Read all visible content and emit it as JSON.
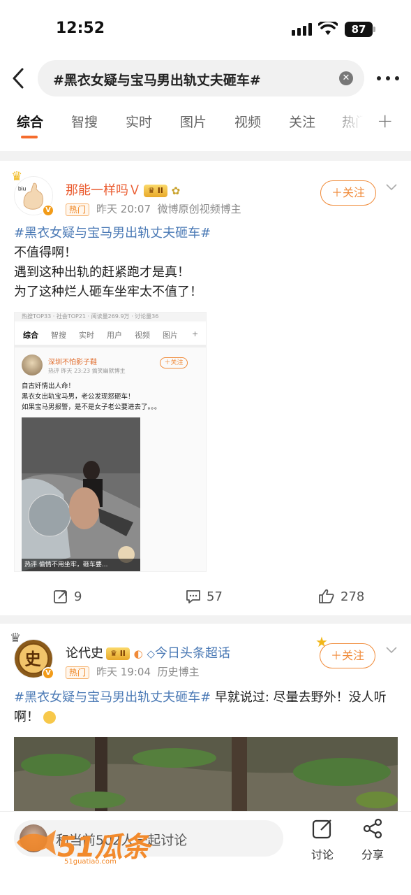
{
  "status_bar": {
    "time": "12:52",
    "battery": "87"
  },
  "search": {
    "query": "#黑衣女疑与宝马男出轨丈夫砸车#"
  },
  "tabs": [
    "综合",
    "智搜",
    "实时",
    "图片",
    "视频",
    "关注",
    "热门"
  ],
  "posts": [
    {
      "username": "那能一样吗Ｖ",
      "level": "II",
      "hot_badge": "热门",
      "time": "昨天 20:07",
      "source": "微博原创视频博主",
      "follow_label": "＋关注",
      "hashtag": "#黑衣女疑与宝马男出轨丈夫砸车#",
      "lines": [
        "不值得啊！",
        "遇到这种出轨的赶紧跑才是真！",
        "为了这种烂人砸车坐牢太不值了！"
      ],
      "repost_count": "9",
      "comment_count": "57",
      "like_count": "278",
      "embedded": {
        "top_text": "热搜TOP33 · 社会TOP21 · 阅读量269.9万 · 讨论量36",
        "tabs": [
          "综合",
          "智搜",
          "实时",
          "用户",
          "视频",
          "图片"
        ],
        "username": "深圳不怕影子鞋",
        "meta": "热评   昨天 23:23  搞笑幽默博主",
        "follow_label": "＋关注",
        "lines": [
          "自古奸情出人命！",
          "黑衣女出轨宝马男，老公发现怒砸车！",
          "如果宝马男报警，是不是女子老公要进去了。。。"
        ],
        "caption": "热评  偷情不用坐牢，砸车要..."
      }
    },
    {
      "username": "论代史",
      "level": "II",
      "super_topic": "今日头条超话",
      "hot_badge": "热门",
      "time": "昨天 19:04",
      "source": "历史博主",
      "follow_label": "＋关注",
      "hashtag": "#黑衣女疑与宝马男出轨丈夫砸车#",
      "text_after_tag": " 早就说过: 尽量去野外！没人听啊！"
    }
  ],
  "bottom_bar": {
    "input_placeholder": "和当前502人一起讨论",
    "discuss_label": "讨论",
    "share_label": "分享"
  },
  "watermark": {
    "brand": "51瓜条",
    "url": "51guatiao.com"
  },
  "colors": {
    "accent": "#f56c2d",
    "link": "#4a79b5",
    "username": "#ea5a2e"
  }
}
